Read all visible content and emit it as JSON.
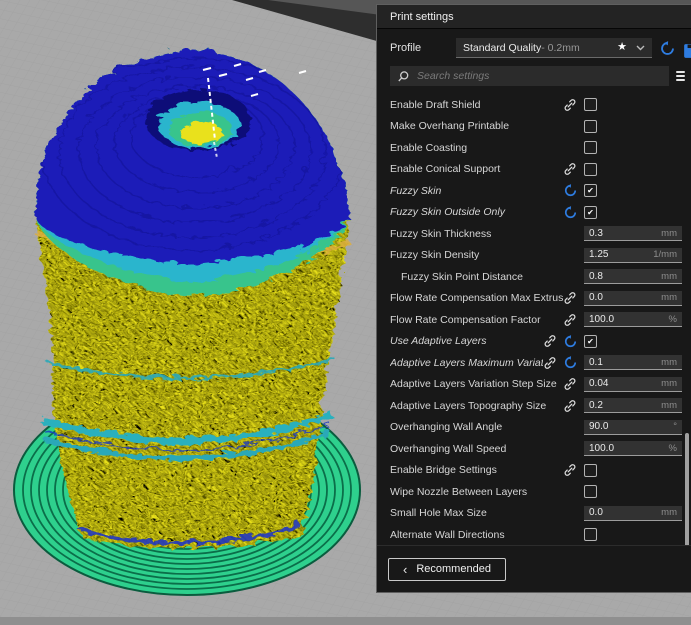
{
  "panel": {
    "title": "Print settings",
    "profile": {
      "label": "Profile",
      "value": "Standard Quality",
      "value_suffix": " - 0.2mm",
      "accent_blue": "#2e7ce0"
    },
    "search": {
      "placeholder": "Search settings"
    },
    "settings": [
      {
        "label": "Enable Draft Shield",
        "type": "checkbox",
        "checked": false,
        "link": true
      },
      {
        "label": "Make Overhang Printable",
        "type": "checkbox",
        "checked": false
      },
      {
        "label": "Enable Coasting",
        "type": "checkbox",
        "checked": false
      },
      {
        "label": "Enable Conical Support",
        "type": "checkbox",
        "checked": false,
        "link": true
      },
      {
        "label": "Fuzzy Skin",
        "type": "checkbox",
        "checked": true,
        "undo": true,
        "italic": true
      },
      {
        "label": "Fuzzy Skin Outside Only",
        "type": "checkbox",
        "checked": true,
        "undo": true,
        "italic": true
      },
      {
        "label": "Fuzzy Skin Thickness",
        "type": "number",
        "value": "0.3",
        "unit": "mm"
      },
      {
        "label": "Fuzzy Skin Density",
        "type": "number",
        "value": "1.25",
        "unit": "1/mm"
      },
      {
        "label": "Fuzzy Skin Point Distance",
        "type": "number",
        "value": "0.8",
        "unit": "mm",
        "indent": true
      },
      {
        "label": "Flow Rate Compensation Max Extrusion Offset",
        "type": "number",
        "value": "0.0",
        "unit": "mm",
        "link": true
      },
      {
        "label": "Flow Rate Compensation Factor",
        "type": "number",
        "value": "100.0",
        "unit": "%",
        "link": true
      },
      {
        "label": "Use Adaptive Layers",
        "type": "checkbox",
        "checked": true,
        "link": true,
        "undo": true,
        "italic": true
      },
      {
        "label": "Adaptive Layers Maximum Variation",
        "type": "number",
        "value": "0.1",
        "unit": "mm",
        "link": true,
        "undo": true,
        "italic": true
      },
      {
        "label": "Adaptive Layers Variation Step Size",
        "type": "number",
        "value": "0.04",
        "unit": "mm",
        "link": true
      },
      {
        "label": "Adaptive Layers Topography Size",
        "type": "number",
        "value": "0.2",
        "unit": "mm",
        "link": true
      },
      {
        "label": "Overhanging Wall Angle",
        "type": "number",
        "value": "90.0",
        "unit": "°"
      },
      {
        "label": "Overhanging Wall Speed",
        "type": "number",
        "value": "100.0",
        "unit": "%"
      },
      {
        "label": "Enable Bridge Settings",
        "type": "checkbox",
        "checked": false,
        "link": true
      },
      {
        "label": "Wipe Nozzle Between Layers",
        "type": "checkbox",
        "checked": false
      },
      {
        "label": "Small Hole Max Size",
        "type": "number",
        "value": "0.0",
        "unit": "mm"
      },
      {
        "label": "Alternate Wall Directions",
        "type": "checkbox",
        "checked": false
      }
    ],
    "footer": {
      "back_chevron": "‹",
      "back_label": "Recommended"
    }
  },
  "viewport": {
    "scene": "layer-preview-of-sliced-vase-model",
    "colors": {
      "build_plate": "#a9a9a9",
      "background_dark": "#303030",
      "model_skin_yellow": "#e9e11e",
      "model_top_blue": "#1c1cb8",
      "band_cyan": "#2ab5cd",
      "band_green": "#38c48c",
      "brim_green": "#2ed08d",
      "travel_moves_white": "#ffffff"
    }
  }
}
